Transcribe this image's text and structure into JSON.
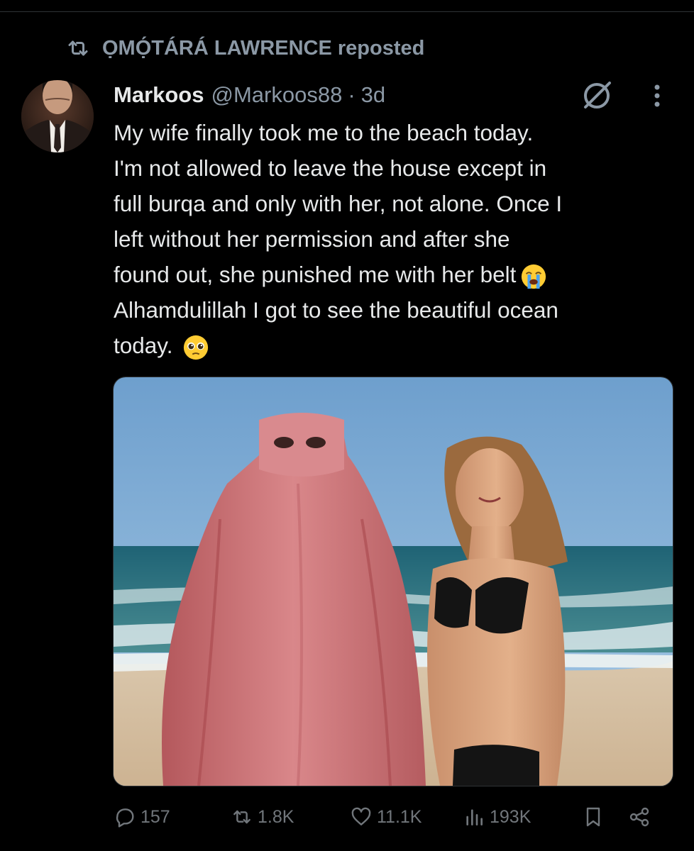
{
  "repost": {
    "text": "ỌMỌ́TÁRÁ LAWRENCE reposted",
    "icon": "repost-icon"
  },
  "tweet": {
    "author_name": "Markoos",
    "handle": "@Markoos88",
    "separator": "·",
    "time": "3d",
    "lines": [
      "My wife finally took me to the beach today.",
      "I'm not allowed to leave the house except in",
      "full burqa and only with her, not alone. Once I",
      "left without her permission and after she",
      "found out, she punished me with her belt",
      "Alhamdulillah I got to see the beautiful ocean",
      "today."
    ],
    "emoji_1": "loudly-crying-face",
    "emoji_2": "pleading-face"
  },
  "actions": {
    "replies": "157",
    "reposts": "1.8K",
    "likes": "11.1K",
    "views": "193K"
  },
  "colors": {
    "background": "#000000",
    "text": "#e7e9ea",
    "muted": "#71767b",
    "secondary": "#8b98a5"
  }
}
